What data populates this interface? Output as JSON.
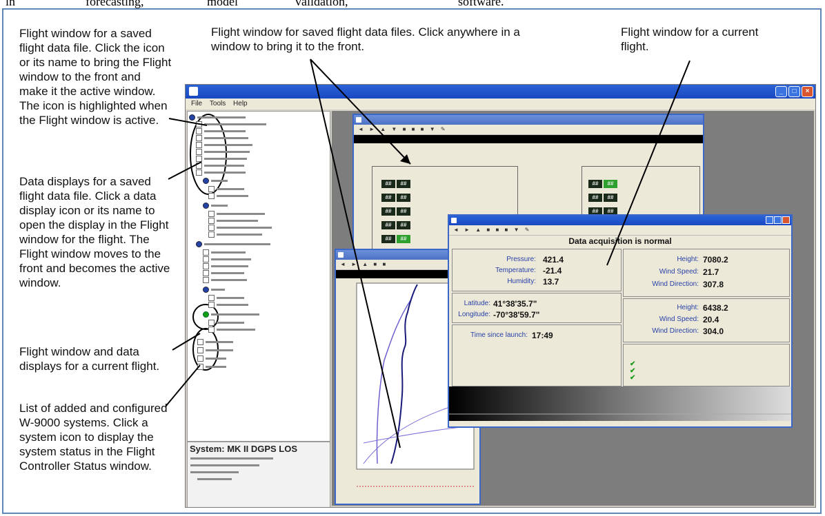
{
  "doc_strip": {
    "word_1": "in",
    "word_2": "forecasting,",
    "word_3": "model",
    "word_4": "validation,",
    "word_5": "software."
  },
  "annotations": {
    "note_1": "Flight window for a saved flight data file. Click the icon or its name to bring the Flight window to the front and make it the active window. The icon is highlighted when the Flight window is active.",
    "note_2": "Data displays for a saved flight data file. Click a data display icon or its name to open the display in the Flight window for the flight. The Flight window moves to the front and becomes the active window.",
    "note_3": "Flight window and data displays for a current flight.",
    "note_4": "List of added and configured W-9000 systems. Click a system icon to display the system status in the Flight Controller Status window.",
    "top_center": "Flight window for saved flight data files. Click anywhere in a window to bring it to the front.",
    "top_right": "Flight window for a current flight."
  },
  "app": {
    "menu": [
      "File",
      "Tools",
      "Help"
    ]
  },
  "system_panel": {
    "title": "System: MK II DGPS LOS"
  },
  "current_flight_window": {
    "status_banner": "Data acquisition is normal",
    "ptu": {
      "pressure_label": "Pressure:",
      "pressure_value": "421.4",
      "temperature_label": "Temperature:",
      "temperature_value": "-21.4",
      "humidity_label": "Humidity:",
      "humidity_value": "13.7"
    },
    "location": {
      "latitude_label": "Latitude:",
      "latitude_value": "41°38'35.7\"",
      "longitude_label": "Longitude:",
      "longitude_value": "-70°38'59.7\""
    },
    "unsmoothed_wind": {
      "height_label": "Height:",
      "height_value": "7080.2",
      "speed_label": "Wind Speed:",
      "speed_value": "21.7",
      "direction_label": "Wind Direction:",
      "direction_value": "307.8"
    },
    "smoothed_wind": {
      "height_label": "Height:",
      "height_value": "6438.2",
      "speed_label": "Wind Speed:",
      "speed_value": "20.4",
      "direction_label": "Wind Direction:",
      "direction_value": "304.0"
    },
    "temporal": {
      "time_since_launch_label": "Time since launch:",
      "time_since_launch_value": "17:49"
    }
  },
  "colors": {
    "frame_border": "#5f86b8",
    "titlebar_blue": "#1948c2",
    "status_green": "#2ea02e",
    "label_blue": "#2840a8",
    "temp_trace": "#2a2a9a",
    "humidity_trace": "#c0394a"
  }
}
